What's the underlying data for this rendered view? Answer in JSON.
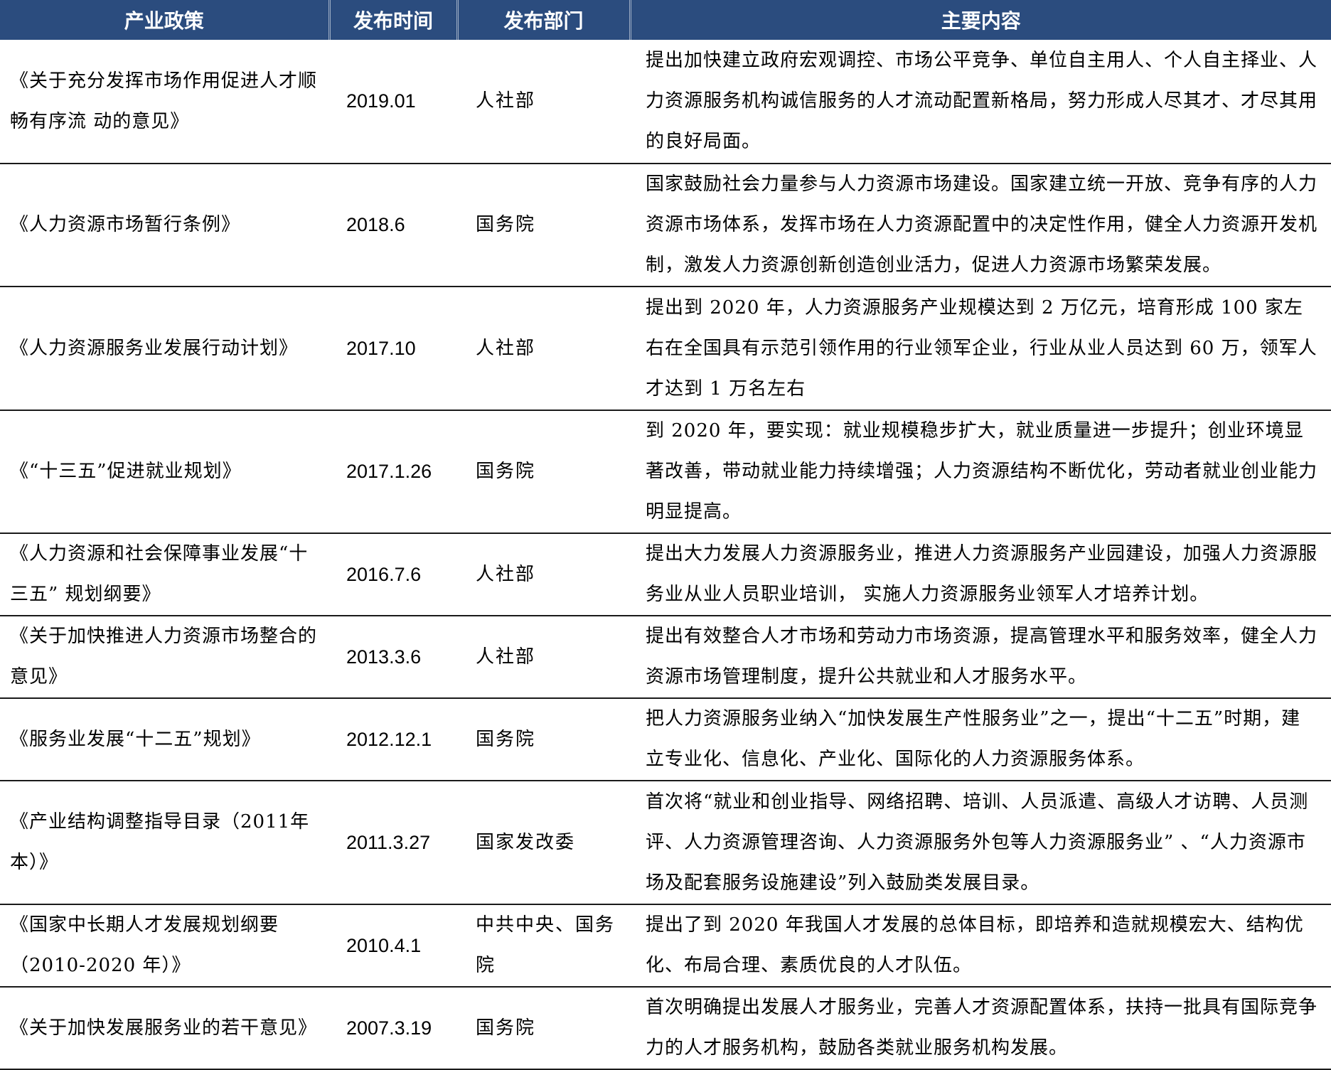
{
  "table": {
    "headers": [
      "产业政策",
      "发布时间",
      "发布部门",
      "主要内容"
    ],
    "rows": [
      {
        "policy": "《关于充分发挥市场作用促进人才顺畅有序流 动的意见》",
        "date": "2019.01",
        "department": "人社部",
        "content": "提出加快建立政府宏观调控、市场公平竞争、单位自主用人、个人自主择业、人力资源服务机构诚信服务的人才流动配置新格局，努力形成人尽其才、才尽其用的良好局面。"
      },
      {
        "policy": "《人力资源市场暂行条例》",
        "date": "2018.6",
        "department": "国务院",
        "content": "国家鼓励社会力量参与人力资源市场建设。国家建立统一开放、竞争有序的人力资源市场体系，发挥市场在人力资源配置中的决定性作用，健全人力资源开发机制，激发人力资源创新创造创业活力，促进人力资源市场繁荣发展。"
      },
      {
        "policy": "《人力资源服务业发展行动计划》",
        "date": "2017.10",
        "department": "人社部",
        "content": "提出到 2020 年，人力资源服务产业规模达到 2 万亿元，培育形成 100 家左右在全国具有示范引领作用的行业领军企业，行业从业人员达到 60 万，领军人才达到 1 万名左右"
      },
      {
        "policy": "《“十三五”促进就业规划》",
        "date": "2017.1.26",
        "department": "国务院",
        "content": "到 2020 年，要实现：就业规模稳步扩大，就业质量进一步提升；创业环境显著改善，带动就业能力持续增强；人力资源结构不断优化，劳动者就业创业能力明显提高。"
      },
      {
        "policy": "《人力资源和社会保障事业发展“十三五” 规划纲要》",
        "date": "2016.7.6",
        "department": "人社部",
        "content": "提出大力发展人力资源服务业，推进人力资源服务产业园建设，加强人力资源服务业从业人员职业培训， 实施人力资源服务业领军人才培养计划。"
      },
      {
        "policy": "《关于加快推进人力资源市场整合的意见》",
        "date": "2013.3.6",
        "department": "人社部",
        "content": "提出有效整合人才市场和劳动力市场资源，提高管理水平和服务效率，健全人力资源市场管理制度，提升公共就业和人才服务水平。"
      },
      {
        "policy": "《服务业发展“十二五”规划》",
        "date": "2012.12.1",
        "department": "国务院",
        "content": "把人力资源服务业纳入“加快发展生产性服务业”之一，提出“十二五”时期，建立专业化、信息化、产业化、国际化的人力资源服务体系。"
      },
      {
        "policy": "《产业结构调整指导目录（2011年本）》",
        "date": "2011.3.27",
        "department": "国家发改委",
        "content": "首次将“就业和创业指导、网络招聘、培训、人员派遣、高级人才访聘、人员测评、人力资源管理咨询、人力资源服务外包等人力资源服务业” 、“人力资源市场及配套服务设施建设”列入鼓励类发展目录。"
      },
      {
        "policy": "《国家中长期人才发展规划纲要（2010-2020 年）》",
        "date": "2010.4.1",
        "department": "中共中央、国务院",
        "content": "提出了到 2020 年我国人才发展的总体目标，即培养和造就规模宏大、结构优化、布局合理、素质优良的人才队伍。"
      },
      {
        "policy": "《关于加快发展服务业的若干意见》",
        "date": "2007.3.19",
        "department": "国务院",
        "content": "首次明确提出发展人才服务业，完善人才资源配置体系，扶持一批具有国际竞争力的人才服务机构，鼓励各类就业服务机构发展。"
      }
    ]
  }
}
